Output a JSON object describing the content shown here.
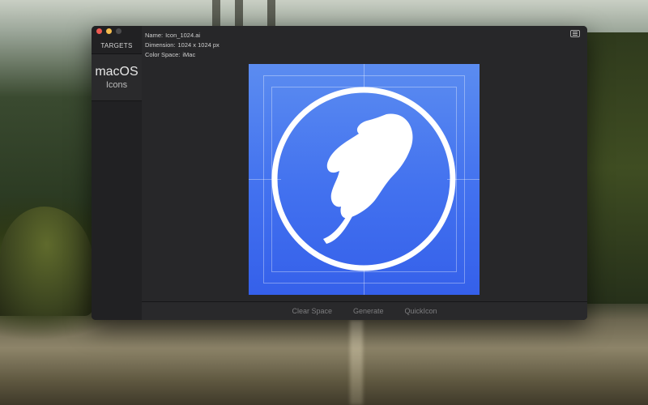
{
  "sidebar": {
    "header": "TARGETS",
    "items": [
      {
        "line1": "macOS",
        "line2": "Icons"
      }
    ]
  },
  "file_info": {
    "name_label": "Name:",
    "name_value": "Icon_1024.ai",
    "dimension_label": "Dimension:",
    "dimension_value": "1024 x 1024 px",
    "colorspace_label": "Color Space:",
    "colorspace_value": "iMac"
  },
  "bottom_bar": {
    "clear_space": "Clear Space",
    "generate": "Generate",
    "quickicon": "QuickIcon"
  },
  "icons": {
    "window_controls": [
      "close-dot",
      "minimize-dot",
      "zoom-dot"
    ],
    "menu": "list-menu-icon",
    "artwork": "feather-icon"
  },
  "colors": {
    "close": "#ee5a52",
    "minimize": "#f5bd4f",
    "icon_blue_top": "#5b8cf0",
    "icon_blue_bottom": "#3560ea"
  }
}
